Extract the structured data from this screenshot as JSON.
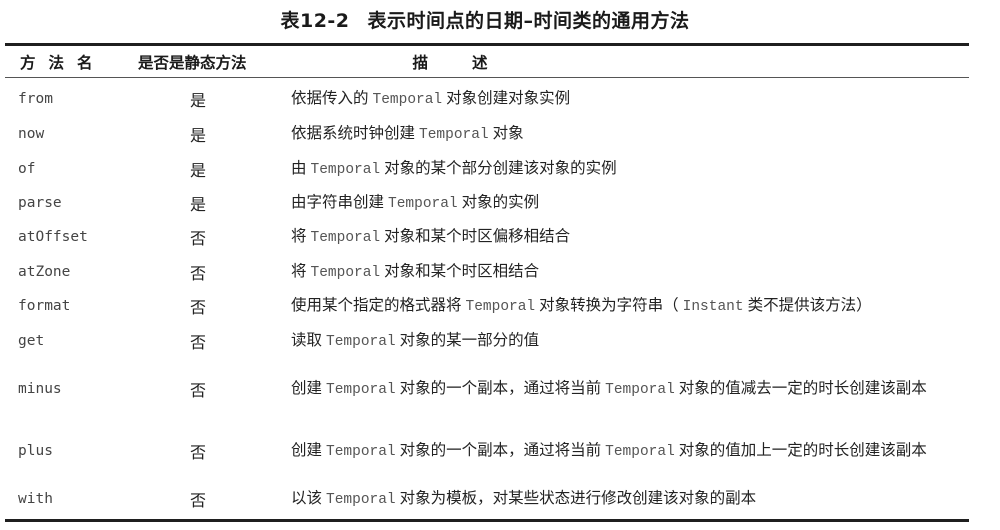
{
  "caption": {
    "number": "表12-2",
    "title": "表示时间点的日期–时间类的通用方法"
  },
  "table": {
    "headers": {
      "name": "方法名",
      "is_static": "是否是静态方法",
      "description": "描述"
    },
    "rows": [
      {
        "name": "from",
        "is_static": "是",
        "description": [
          {
            "t": "text",
            "v": "依据传入的"
          },
          {
            "t": "code",
            "v": "Temporal"
          },
          {
            "t": "text",
            "v": "对象创建对象实例"
          }
        ]
      },
      {
        "name": "now",
        "is_static": "是",
        "description": [
          {
            "t": "text",
            "v": "依据系统时钟创建"
          },
          {
            "t": "code",
            "v": "Temporal"
          },
          {
            "t": "text",
            "v": "对象"
          }
        ]
      },
      {
        "name": "of",
        "is_static": "是",
        "description": [
          {
            "t": "text",
            "v": "由"
          },
          {
            "t": "code",
            "v": "Temporal"
          },
          {
            "t": "text",
            "v": "对象的某个部分创建该对象的实例"
          }
        ]
      },
      {
        "name": "parse",
        "is_static": "是",
        "description": [
          {
            "t": "text",
            "v": "由字符串创建"
          },
          {
            "t": "code",
            "v": "Temporal"
          },
          {
            "t": "text",
            "v": "对象的实例"
          }
        ]
      },
      {
        "name": "atOffset",
        "is_static": "否",
        "description": [
          {
            "t": "text",
            "v": "将"
          },
          {
            "t": "code",
            "v": "Temporal"
          },
          {
            "t": "text",
            "v": "对象和某个时区偏移相结合"
          }
        ]
      },
      {
        "name": "atZone",
        "is_static": "否",
        "description": [
          {
            "t": "text",
            "v": "将"
          },
          {
            "t": "code",
            "v": "Temporal"
          },
          {
            "t": "text",
            "v": "对象和某个时区相结合"
          }
        ]
      },
      {
        "name": "format",
        "is_static": "否",
        "description": [
          {
            "t": "text",
            "v": "使用某个指定的格式器将"
          },
          {
            "t": "code",
            "v": "Temporal"
          },
          {
            "t": "text",
            "v": "对象转换为字符串（"
          },
          {
            "t": "code",
            "v": "Instant"
          },
          {
            "t": "text",
            "v": "类不提供该方法）"
          }
        ]
      },
      {
        "name": "get",
        "is_static": "否",
        "description": [
          {
            "t": "text",
            "v": "读取"
          },
          {
            "t": "code",
            "v": "Temporal"
          },
          {
            "t": "text",
            "v": "对象的某一部分的值"
          }
        ]
      },
      {
        "name": "minus",
        "is_static": "否",
        "tall": true,
        "description": [
          {
            "t": "text",
            "v": "创建"
          },
          {
            "t": "code",
            "v": "Temporal"
          },
          {
            "t": "text",
            "v": "对象的一个副本，通过将当前"
          },
          {
            "t": "code",
            "v": "Temporal"
          },
          {
            "t": "text",
            "v": "对象的值减去一定的时长创建该副本"
          }
        ]
      },
      {
        "name": "plus",
        "is_static": "否",
        "tall": true,
        "description": [
          {
            "t": "text",
            "v": "创建"
          },
          {
            "t": "code",
            "v": "Temporal"
          },
          {
            "t": "text",
            "v": "对象的一个副本，通过将当前"
          },
          {
            "t": "code",
            "v": "Temporal"
          },
          {
            "t": "text",
            "v": "对象的值加上一定的时长创建该副本"
          }
        ]
      },
      {
        "name": "with",
        "is_static": "否",
        "description": [
          {
            "t": "text",
            "v": "以该"
          },
          {
            "t": "code",
            "v": "Temporal"
          },
          {
            "t": "text",
            "v": "对象为模板，对某些状态进行修改创建该对象的副本"
          }
        ]
      }
    ]
  }
}
